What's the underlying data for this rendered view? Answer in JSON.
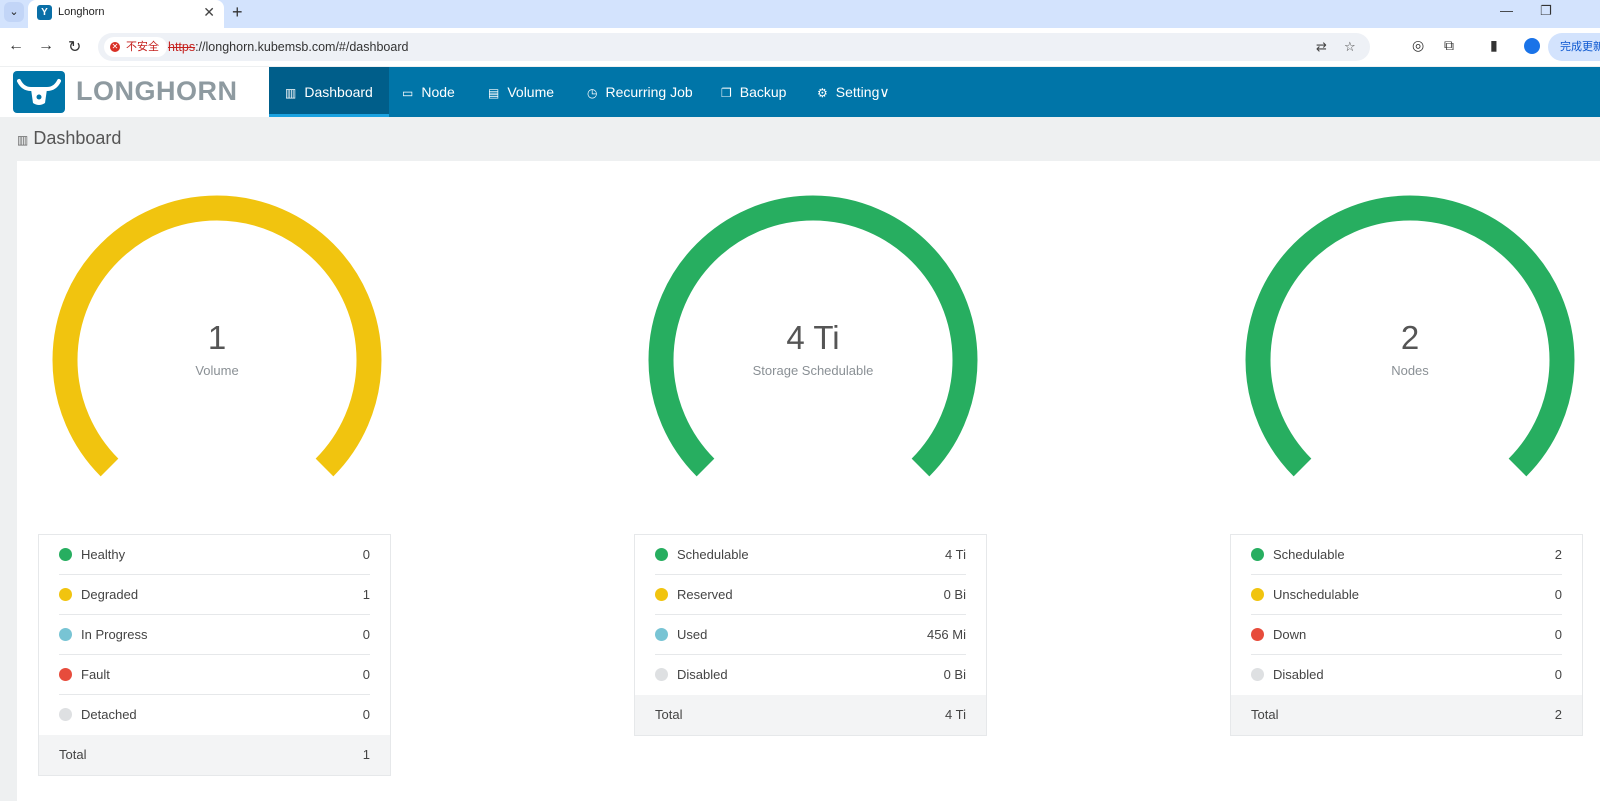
{
  "browser": {
    "tab_title": "Longhorn",
    "new_tab_icon": "+",
    "security_label": "不安全",
    "url_scheme": "https",
    "url_rest": "://longhorn.kubemsb.com/#/dashboard",
    "update_button": "完成更新"
  },
  "app": {
    "logo_text": "LONGHORN",
    "nav": [
      {
        "label": "Dashboard",
        "icon": "chart-icon",
        "active": true
      },
      {
        "label": "Node",
        "icon": "laptop-icon"
      },
      {
        "label": "Volume",
        "icon": "database-icon"
      },
      {
        "label": "Recurring Job",
        "icon": "clock-icon"
      },
      {
        "label": "Backup",
        "icon": "copy-icon"
      },
      {
        "label": "Setting",
        "icon": "gear-icon"
      }
    ],
    "page_title": "Dashboard"
  },
  "colors": {
    "brand": "#0075a8",
    "healthy": "#27ae60",
    "warning": "#f1c40f",
    "info": "#78c4d4",
    "danger": "#e74c3c",
    "disabled": "#dee0e2"
  },
  "gauges": [
    {
      "value": "1",
      "label": "Volume",
      "color": "#f1c40f",
      "stats": [
        {
          "label": "Healthy",
          "value": "0",
          "color": "#27ae60"
        },
        {
          "label": "Degraded",
          "value": "1",
          "color": "#f1c40f"
        },
        {
          "label": "In Progress",
          "value": "0",
          "color": "#78c4d4"
        },
        {
          "label": "Fault",
          "value": "0",
          "color": "#e74c3c"
        },
        {
          "label": "Detached",
          "value": "0",
          "color": "#dee0e2"
        }
      ],
      "total_label": "Total",
      "total_value": "1"
    },
    {
      "value": "4 Ti",
      "label": "Storage Schedulable",
      "color": "#27ae60",
      "stats": [
        {
          "label": "Schedulable",
          "value": "4 Ti",
          "color": "#27ae60"
        },
        {
          "label": "Reserved",
          "value": "0 Bi",
          "color": "#f1c40f"
        },
        {
          "label": "Used",
          "value": "456 Mi",
          "color": "#78c4d4"
        },
        {
          "label": "Disabled",
          "value": "0 Bi",
          "color": "#dee0e2"
        }
      ],
      "total_label": "Total",
      "total_value": "4 Ti"
    },
    {
      "value": "2",
      "label": "Nodes",
      "color": "#27ae60",
      "stats": [
        {
          "label": "Schedulable",
          "value": "2",
          "color": "#27ae60"
        },
        {
          "label": "Unschedulable",
          "value": "0",
          "color": "#f1c40f"
        },
        {
          "label": "Down",
          "value": "0",
          "color": "#e74c3c"
        },
        {
          "label": "Disabled",
          "value": "0",
          "color": "#dee0e2"
        }
      ],
      "total_label": "Total",
      "total_value": "2"
    }
  ]
}
